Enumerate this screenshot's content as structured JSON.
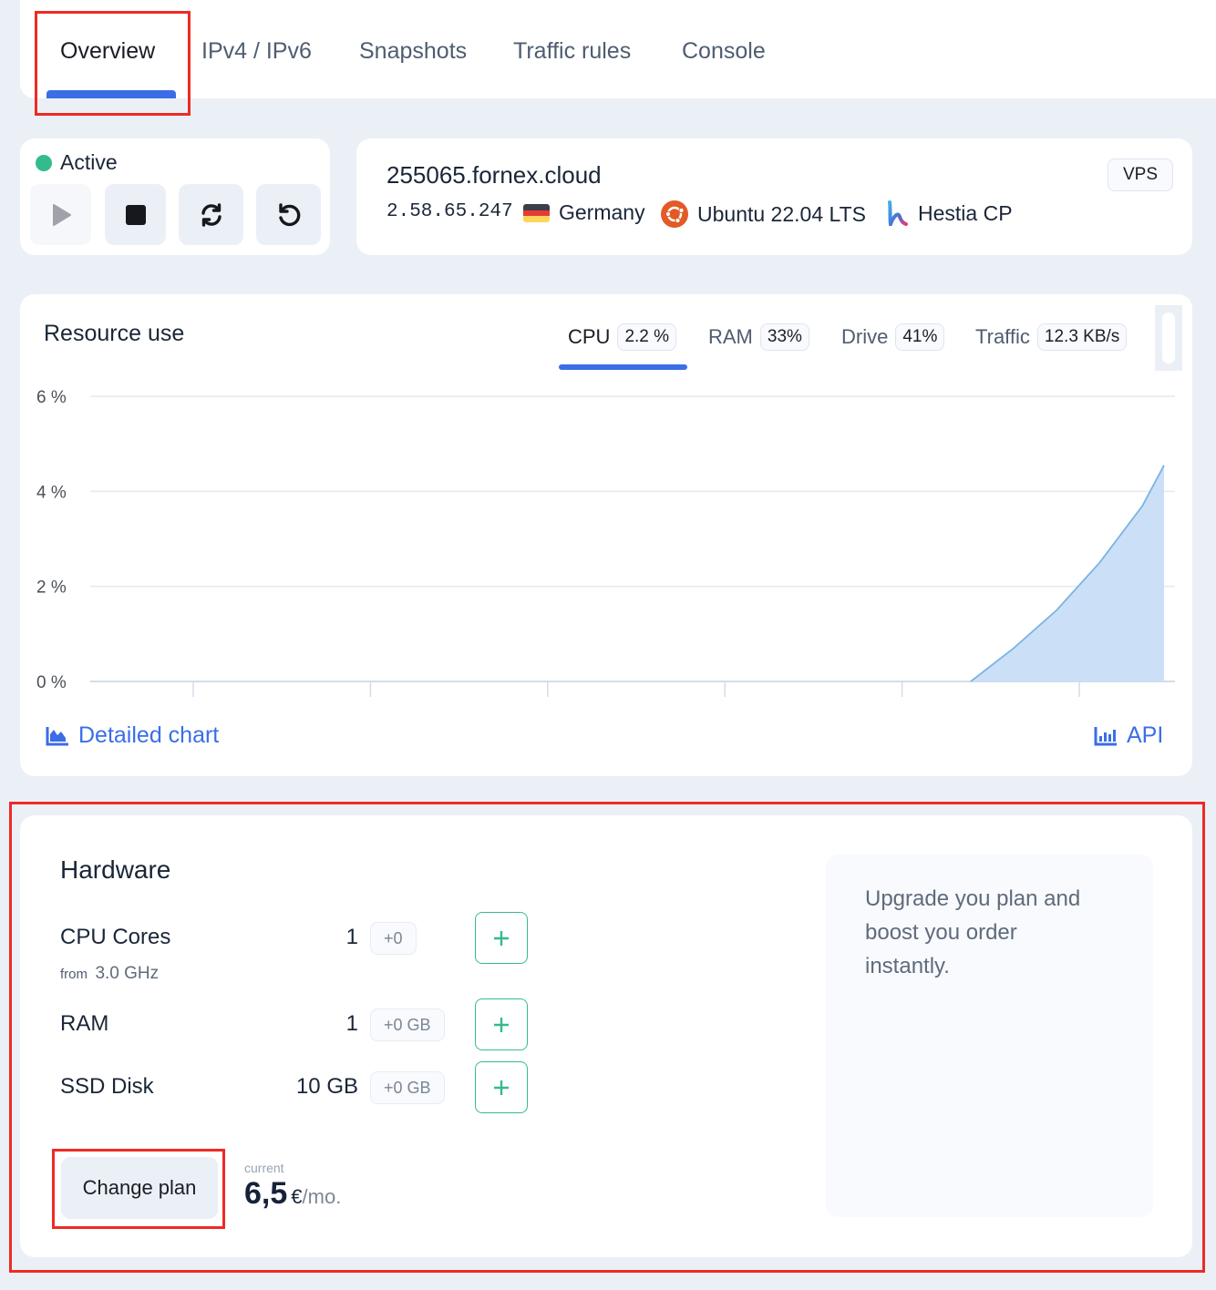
{
  "tabs": [
    {
      "label": "Overview",
      "active": true
    },
    {
      "label": "IPv4 / IPv6",
      "active": false
    },
    {
      "label": "Snapshots",
      "active": false
    },
    {
      "label": "Traffic rules",
      "active": false
    },
    {
      "label": "Console",
      "active": false
    }
  ],
  "status": {
    "label": "Active",
    "color": "#34bb8c",
    "controls": [
      {
        "name": "start",
        "icon": "play-icon",
        "disabled": true
      },
      {
        "name": "stop",
        "icon": "stop-icon",
        "disabled": false
      },
      {
        "name": "restart",
        "icon": "sync-icon",
        "disabled": false
      },
      {
        "name": "reinstall",
        "icon": "undo-icon",
        "disabled": false
      }
    ]
  },
  "server": {
    "hostname": "255065.fornex.cloud",
    "ip": "2.58.65.247",
    "country": "Germany",
    "os": "Ubuntu 22.04 LTS",
    "panel": "Hestia CP",
    "type_badge": "VPS"
  },
  "resources": {
    "title": "Resource use",
    "tabs": [
      {
        "label": "CPU",
        "value": "2.2 %",
        "active": true
      },
      {
        "label": "RAM",
        "value": "33%",
        "active": false
      },
      {
        "label": "Drive",
        "value": "41%",
        "active": false
      },
      {
        "label": "Traffic",
        "value": "12.3 KB/s",
        "active": false
      }
    ],
    "detailed_chart_label": "Detailed chart",
    "api_label": "API"
  },
  "chart_data": {
    "type": "area",
    "title": "CPU",
    "xlabel": "",
    "ylabel": "",
    "y_tick_labels": [
      "0 %",
      "2 %",
      "4 %",
      "6 %"
    ],
    "ylim": [
      0,
      6
    ],
    "x_tick_count": 6,
    "grid": true,
    "series": [
      {
        "name": "CPU",
        "x": [
          0,
          0.82,
          0.86,
          0.9,
          0.94,
          0.98,
          1.0
        ],
        "values": [
          0,
          0,
          0.7,
          1.5,
          2.5,
          3.7,
          4.55
        ]
      }
    ],
    "colors": {
      "fill": "#cbe0f6",
      "line": "#7ab3e6",
      "grid": "#e6e9ee",
      "axis": "#d3dcec"
    }
  },
  "hardware": {
    "title": "Hardware",
    "rows": [
      {
        "label": "CPU Cores",
        "value": "1",
        "delta": "+0",
        "sub_from": "from",
        "sub_value": "3.0 GHz"
      },
      {
        "label": "RAM",
        "value": "1",
        "delta": "+0 GB"
      },
      {
        "label": "SSD Disk",
        "value": "10 GB",
        "delta": "+0 GB"
      }
    ],
    "change_plan_label": "Change plan",
    "price_caption": "current",
    "price_amount": "6,5",
    "price_currency": "€",
    "price_period": "/mo.",
    "upgrade_text": "Upgrade you plan and boost you order instantly."
  },
  "colors": {
    "accent": "#3b6ee6",
    "success": "#34bb8c",
    "highlight": "#ee2a24",
    "background": "#ebf0f7"
  }
}
